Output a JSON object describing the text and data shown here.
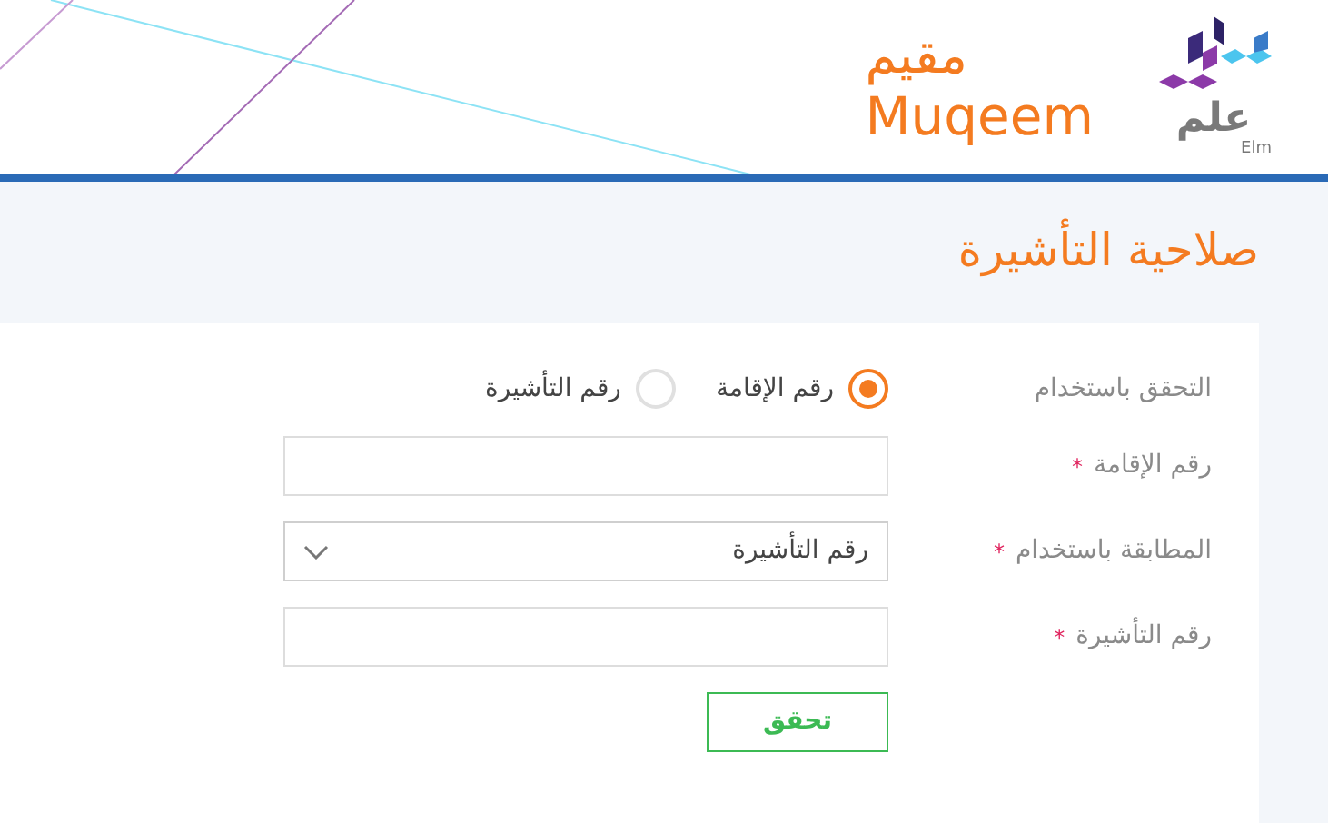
{
  "header": {
    "brand_arabic": "مقيم",
    "brand_latin": "Muqeem",
    "logo_arabic": "علم",
    "logo_latin": "Elm"
  },
  "page_title": "صلاحية التأشيرة",
  "form": {
    "verify_label": "التحقق باستخدام",
    "verify_options": [
      {
        "label": "رقم الإقامة",
        "selected": true
      },
      {
        "label": "رقم التأشيرة",
        "selected": false
      }
    ],
    "fields": [
      {
        "kind": "text",
        "label": "رقم الإقامة",
        "required_mark": "*"
      },
      {
        "kind": "select",
        "label": "المطابقة باستخدام",
        "required_mark": "*",
        "value": "رقم التأشيرة"
      },
      {
        "kind": "text",
        "label": "رقم التأشيرة",
        "required_mark": "*"
      }
    ],
    "submit": "تحقق"
  }
}
